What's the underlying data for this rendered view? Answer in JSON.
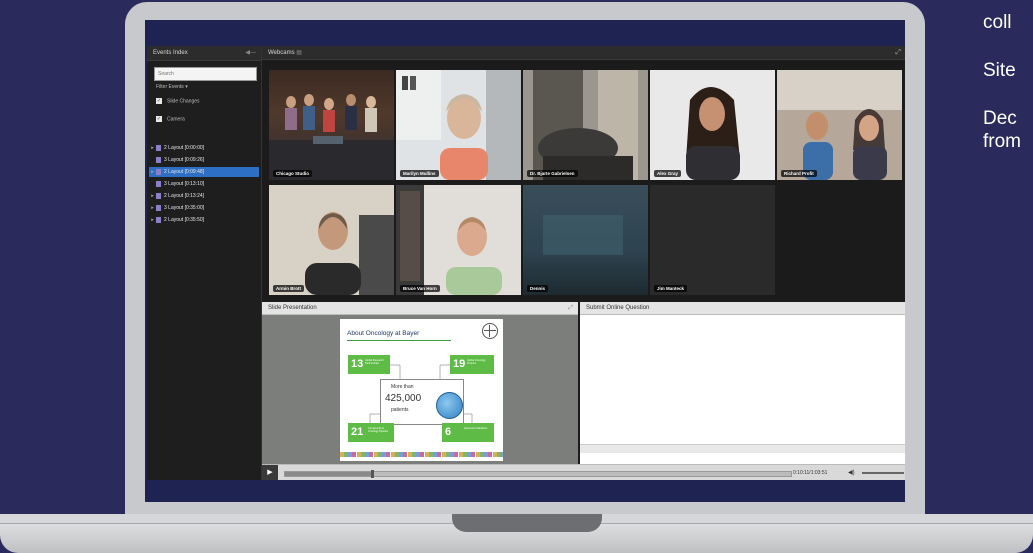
{
  "side_text": {
    "line1": "coll",
    "line2": "Site",
    "line3": "Dec",
    "line4": "from"
  },
  "events_panel": {
    "title": "Events Index",
    "search_placeholder": "Search",
    "filter_label": "Filter Events",
    "checkboxes": [
      {
        "label": "Slide Changes",
        "checked": true
      },
      {
        "label": "Camera",
        "checked": true
      }
    ],
    "layouts": [
      {
        "label": "2 Layout [0:00:00]",
        "selected": false,
        "arrow": true
      },
      {
        "label": "3 Layout [0:09:26]",
        "selected": false,
        "arrow": false
      },
      {
        "label": "2 Layout [0:09:48]",
        "selected": true,
        "arrow": true
      },
      {
        "label": "3 Layout [0:13:10]",
        "selected": false,
        "arrow": false
      },
      {
        "label": "2 Layout [0:13:24]",
        "selected": false,
        "arrow": true
      },
      {
        "label": "3 Layout [0:35:00]",
        "selected": false,
        "arrow": true
      },
      {
        "label": "2 Layout [0:35:50]",
        "selected": false,
        "arrow": true
      }
    ]
  },
  "webcams": {
    "title": "Webcams",
    "tiles": [
      {
        "name": "Chicago Studio"
      },
      {
        "name": "Marilyn Mullins"
      },
      {
        "name": "Dr. Bjarte Gabrielsen"
      },
      {
        "name": "Alex Gray"
      },
      {
        "name": "Richard Profit"
      },
      {
        "name": "Armin Brott"
      },
      {
        "name": "Bruce Van Horn"
      },
      {
        "name": "Dennis"
      },
      {
        "name": "Jim Manteck"
      }
    ]
  },
  "slide_panel": {
    "title": "Slide Presentation",
    "slide": {
      "title": "About Oncology at Bayer",
      "stat1_num": "13",
      "stat1_text": "Global Research Partnerships",
      "stat2_num": "19",
      "stat2_text": "Global Oncology Projects",
      "stat3_num": "21",
      "stat3_text": "Compounds in Oncology Pipeline",
      "stat4_num": "6",
      "stat4_text": "Approved Indications",
      "center_line1": "More than",
      "center_number": "425,000",
      "center_line3": "patients"
    }
  },
  "question_panel": {
    "title": "Submit Online Question"
  },
  "transport": {
    "time": "0:10:11/1:03:51",
    "progress": 0.17
  }
}
